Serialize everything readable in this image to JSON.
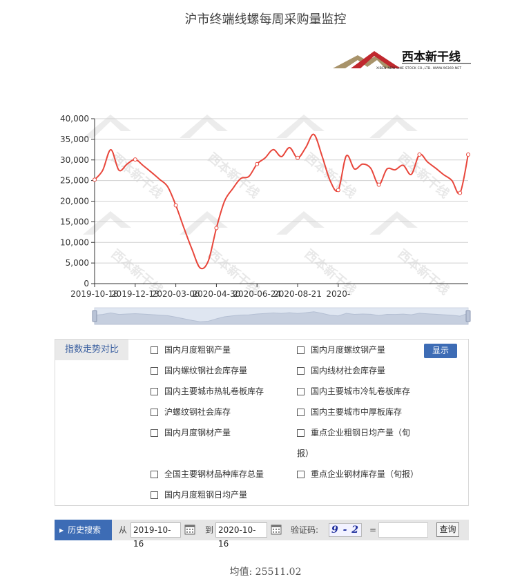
{
  "title": "沪市终端线螺每周采购量监控",
  "logo": {
    "name": "西本新干线",
    "sub": "XIBEN NEW LINE STOCK CO.,LTD.   WWW.96369.NET"
  },
  "watermark": "西本新干线",
  "colors": {
    "line": "#e8463b",
    "accent": "#3d6cb5",
    "brand_red": "#c0282e",
    "brand_tan": "#a8936a"
  },
  "chart_data": {
    "type": "line",
    "title": "沪市终端线螺每周采购量监控",
    "xlabel": "",
    "ylabel": "",
    "ylim": [
      0,
      40000
    ],
    "yticks": [
      "0",
      "5,000",
      "10,000",
      "15,000",
      "20,000",
      "25,000",
      "30,000",
      "35,000",
      "40,000"
    ],
    "xticks": [
      "2019-10-18",
      "2019-12-13",
      "2020-03-06",
      "2020-04-30",
      "2020-06-24",
      "2020-08-21",
      "2020-"
    ],
    "grid": true,
    "legend": "none",
    "series": [
      {
        "values": [
          25200,
          27500,
          32500,
          27500,
          29000,
          30100,
          28600,
          27000,
          25300,
          23500,
          19000,
          13500,
          8300,
          3800,
          5500,
          13500,
          20000,
          23000,
          25500,
          26000,
          29000,
          30500,
          32500,
          30800,
          33000,
          30500,
          33000,
          36200,
          31000,
          25000,
          22700,
          31000,
          27800,
          29000,
          28000,
          24000,
          27800,
          27600,
          28700,
          26500,
          31300,
          29500,
          28000,
          26400,
          25000,
          22000,
          31300
        ]
      }
    ]
  },
  "panel": {
    "tab_label": "指数走势对比",
    "show_button": "显示",
    "options": [
      "国内月度粗钢产量",
      "国内月度螺纹钢产量",
      "国内螺纹钢社会库存量",
      "国内线材社会库存量",
      "国内主要城市热轧卷板库存",
      "国内主要城市冷轧卷板库存",
      "沪螺纹钢社会库存",
      "国内主要城市中厚板库存",
      "国内月度钢材产量",
      "重点企业粗钢日均产量（旬",
      "全国主要钢材品种库存总量",
      "重点企业钢材库存量（旬报）",
      "国内月度粗钢日均产量"
    ],
    "option_wrap": "报）"
  },
  "search": {
    "history_label": "历史搜索",
    "from_label": "从",
    "from_value": "2019-10-16",
    "to_label": "到",
    "to_value": "2020-10-16",
    "captcha_label": "验证码:",
    "captcha_text": "9 - 2",
    "equals": "=",
    "answer_value": "",
    "query_button": "查询"
  },
  "average": {
    "label": "均值:",
    "value": "25511.02"
  }
}
